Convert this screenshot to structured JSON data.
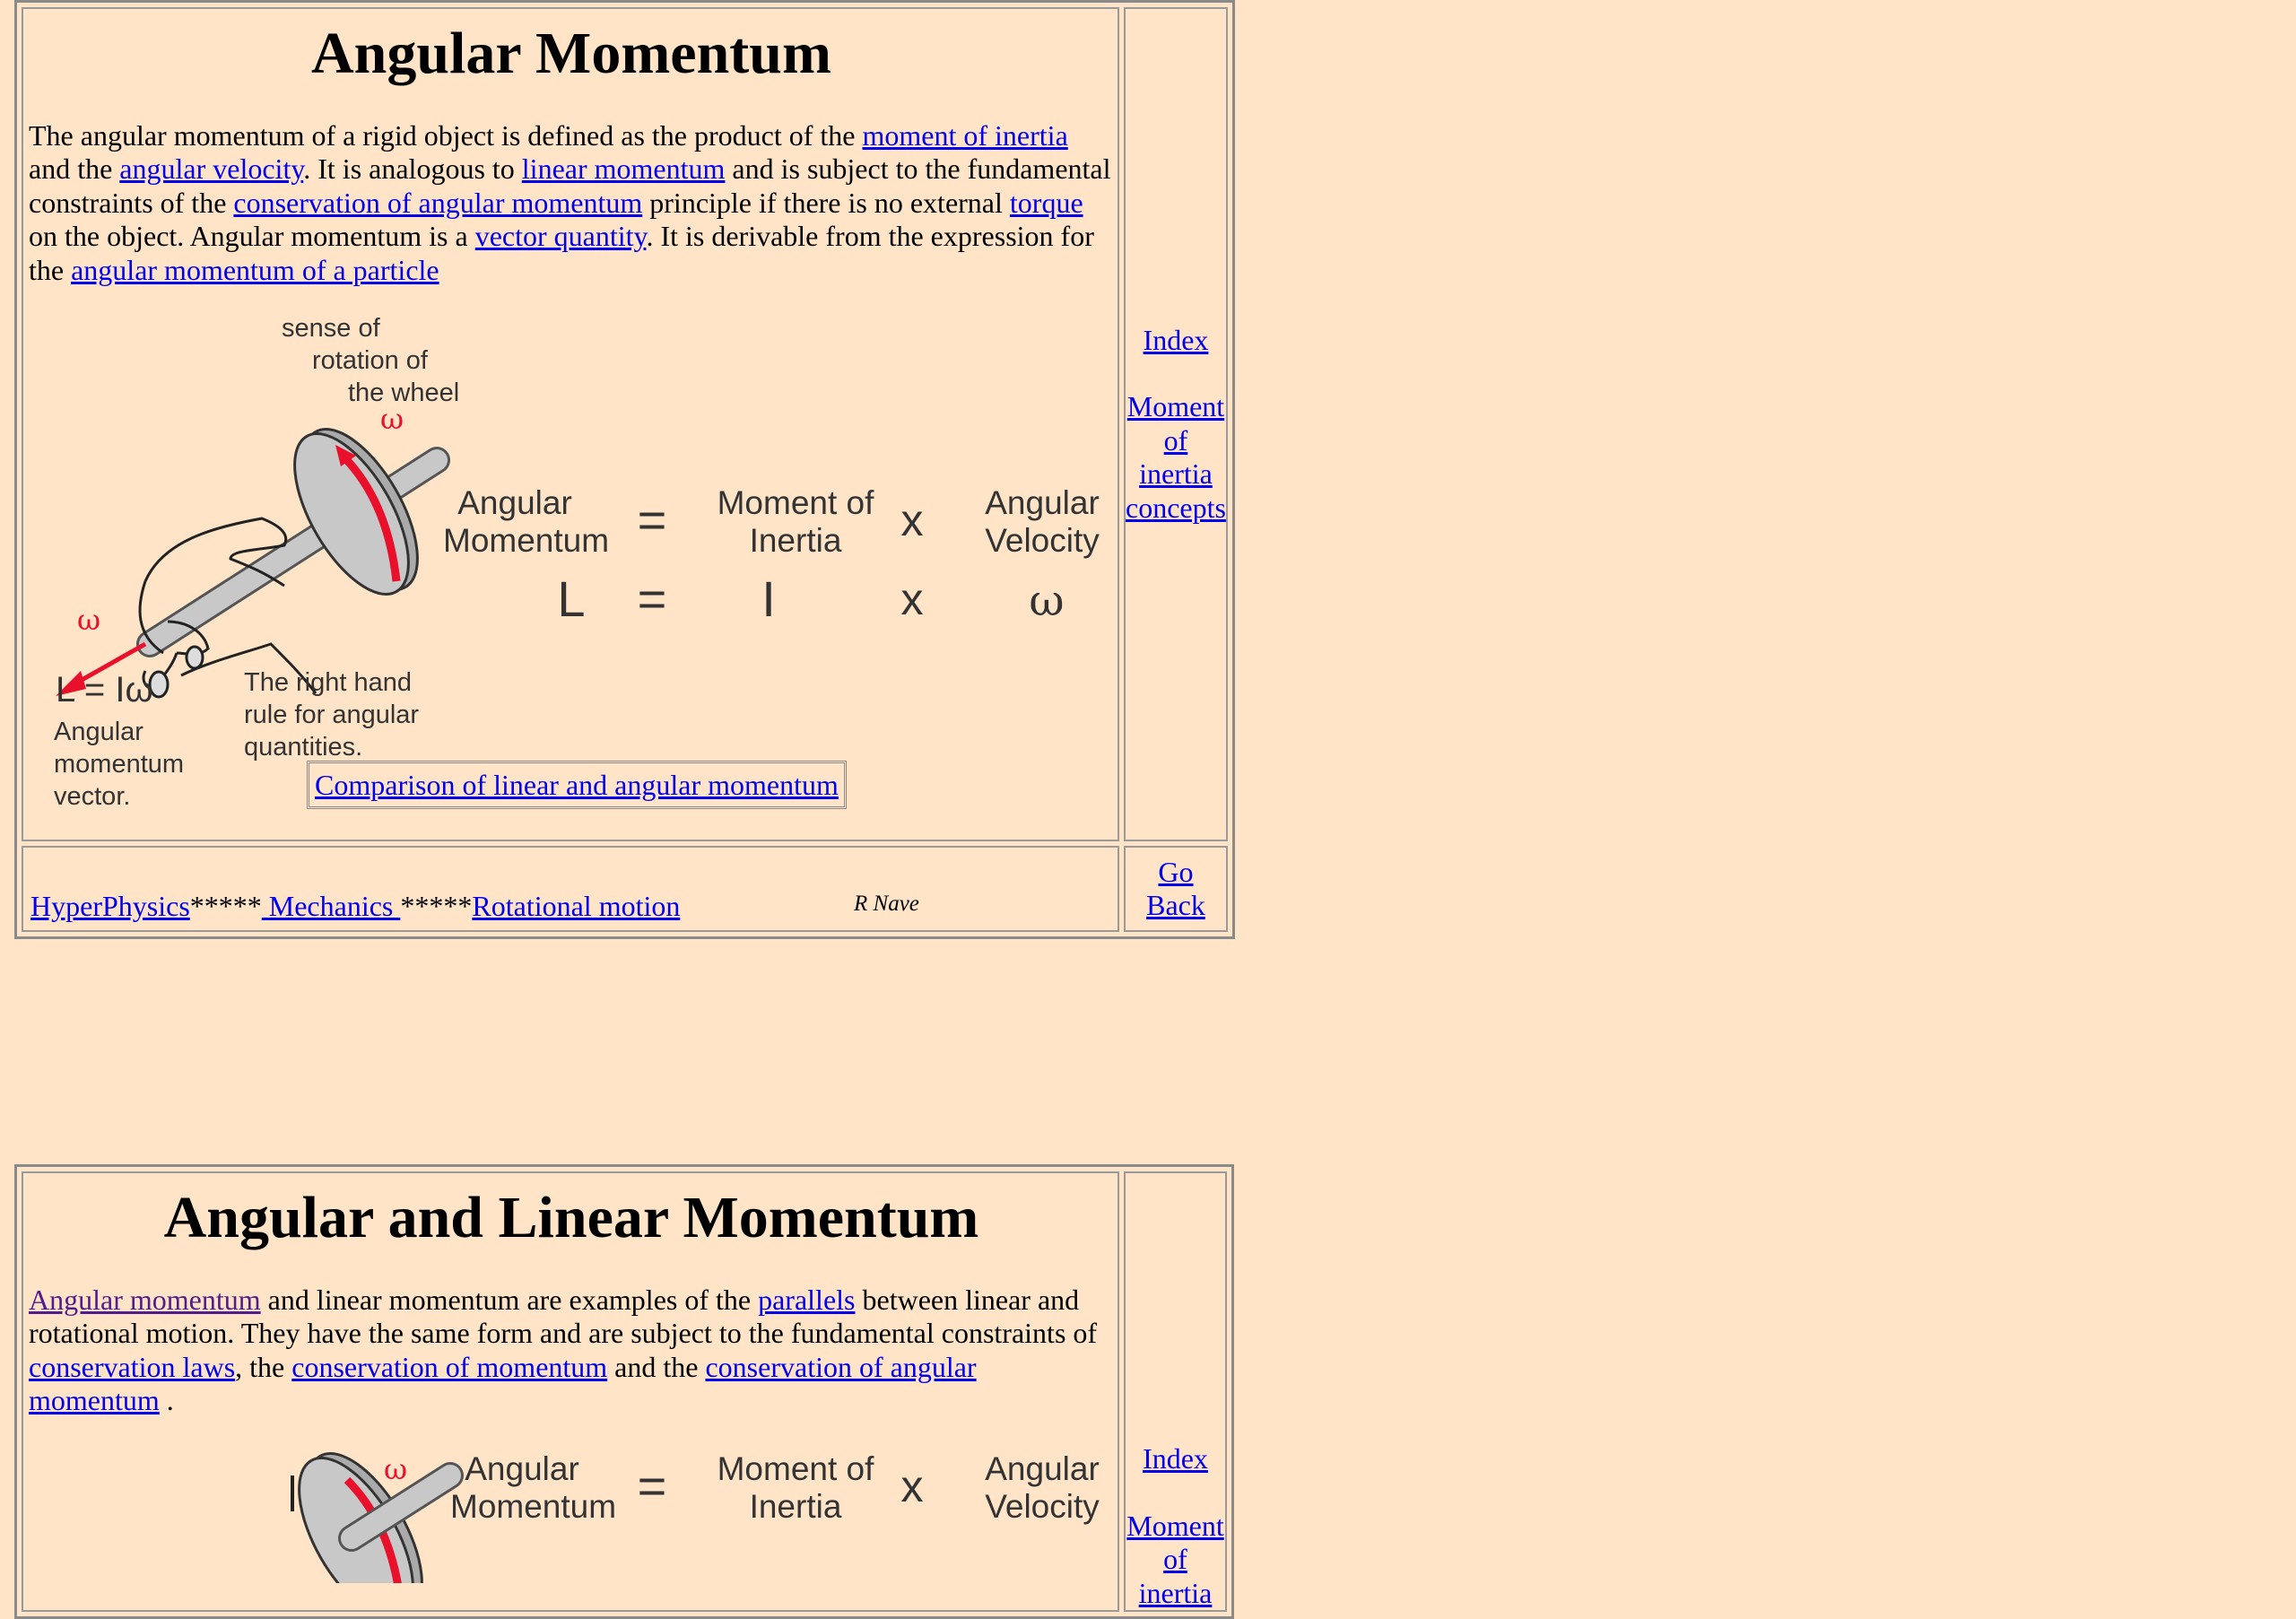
{
  "section1": {
    "title": "Angular Momentum",
    "para": [
      {
        "t": "The angular momentum of a rigid object is defined as the product of the "
      },
      {
        "l": "moment of inertia"
      },
      {
        "t": " and the "
      },
      {
        "l": "angular velocity"
      },
      {
        "t": ". It is analogous to "
      },
      {
        "l": "linear momentum"
      },
      {
        "t": " and is subject to the fundamental constraints of the "
      },
      {
        "l": "conservation of angular momentum"
      },
      {
        "t": " principle if there is no external "
      },
      {
        "l": "torque"
      },
      {
        "t": " on the object. Angular momentum is a "
      },
      {
        "l": "vector quantity"
      },
      {
        "t": ". It is derivable from the expression for the "
      },
      {
        "l": "angular momentum of a particle"
      }
    ],
    "diagram": {
      "sense_label": [
        "sense of",
        "rotation of",
        "the wheel"
      ],
      "omega": "ω",
      "eq_angular_momentum": [
        "Angular",
        "Momentum"
      ],
      "eq_moment_of_inertia": [
        "Moment of",
        "Inertia"
      ],
      "eq_angular_velocity": [
        "Angular",
        "Velocity"
      ],
      "equals": "=",
      "times": "x",
      "sym_L": "L",
      "sym_I": "I",
      "sym_omega": "ω",
      "vector_formula": "L = Iω",
      "vector_caption": [
        "Angular",
        "momentum",
        "vector."
      ],
      "rule_caption": [
        "The right hand",
        "rule for angular",
        "quantities."
      ]
    },
    "comparison_link": "Comparison of linear and angular momentum",
    "side_links": [
      "Index",
      "Moment",
      "of inertia",
      "concepts"
    ],
    "footer": {
      "hyperphysics": "HyperPhysics",
      "sep1": "*****",
      "mechanics": " Mechanics ",
      "sep2": "*****",
      "rotational": "Rotational motion",
      "author": "R Nave",
      "go_back": "Go Back"
    }
  },
  "section2": {
    "title": "Angular and Linear Momentum",
    "para": [
      {
        "v": "Angular momentum"
      },
      {
        "t": " and linear momentum are examples of the "
      },
      {
        "l": "parallels"
      },
      {
        "t": " between linear and rotational motion. They have the same form and are subject to the fundamental constraints of "
      },
      {
        "l": "conservation laws"
      },
      {
        "t": ", the "
      },
      {
        "l": "conservation of momentum"
      },
      {
        "t": " and the "
      },
      {
        "l": "conservation of angular momentum"
      },
      {
        "t": " ."
      }
    ],
    "side_links": [
      "Index",
      "Moment",
      "of inertia"
    ],
    "diagram": {
      "omega": "ω",
      "eq_angular_momentum": [
        "Angular",
        "Momentum"
      ],
      "eq_moment_of_inertia": [
        "Moment of",
        "Inertia"
      ],
      "eq_angular_velocity": [
        "Angular",
        "Velocity"
      ],
      "equals": "=",
      "times": "x"
    }
  },
  "colors": {
    "background": "#ffe4c8",
    "link": "#0000ee",
    "visited": "#551a8b",
    "omega_red": "#e8102a"
  }
}
